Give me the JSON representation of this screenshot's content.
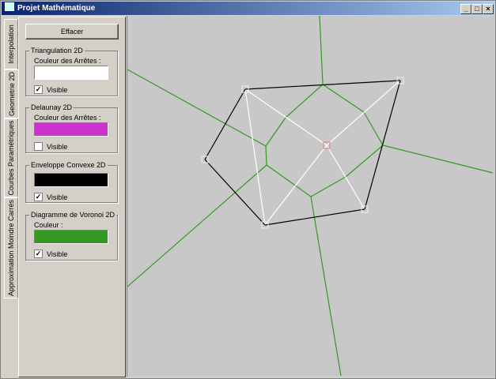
{
  "window": {
    "title": "Projet Mathématique",
    "minimize": "_",
    "maximize": "□",
    "close": "×"
  },
  "tabs": [
    {
      "label": "Interpolation"
    },
    {
      "label": "Geometrie 2D",
      "active": true
    },
    {
      "label": "Courbes Paramétriques"
    },
    {
      "label": "Approximation Moindre Carrés"
    }
  ],
  "panel": {
    "clear_label": "Effacer",
    "groups": [
      {
        "title": "Triangulation 2D",
        "color_label": "Couleur des Arrêtes :",
        "color": "#ffffff",
        "visible_label": "Visible",
        "visible": true
      },
      {
        "title": "Delaunay 2D",
        "color_label": "Couleur des Arrêtes :",
        "color": "#cc33cc",
        "visible_label": "Visible",
        "visible": false
      },
      {
        "title": "Enveloppe Convexe 2D",
        "color": "#000000",
        "visible_label": "Visible",
        "visible": true
      },
      {
        "title": "Diagramme de Voronoi 2D",
        "color_label": "Couleur :",
        "color": "#339922",
        "visible_label": "Visible",
        "visible": true
      }
    ]
  },
  "canvas": {
    "background": "#c8c8c8",
    "hull_color": "#000000",
    "triangulation_color": "#ffffff",
    "voronoi_color": "#339922",
    "selected_point_color": "#e08080"
  }
}
